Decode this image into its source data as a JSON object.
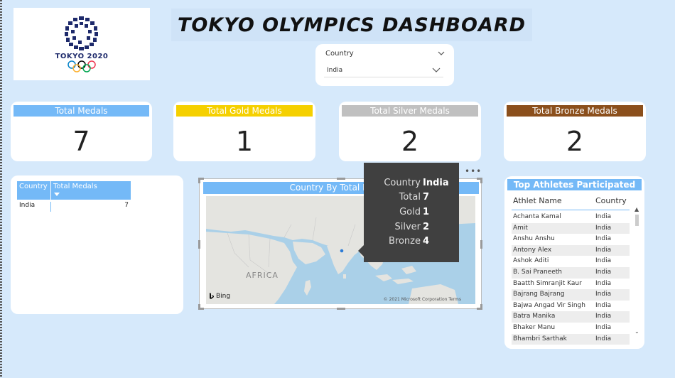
{
  "logo": {
    "text": "TOKYO 2020"
  },
  "title": "TOKYO OLYMPICS DASHBOARD",
  "slicer": {
    "label": "Country",
    "value": "India"
  },
  "kpis": [
    {
      "label": "Total Medals",
      "value": "7",
      "color": "#74b9f7"
    },
    {
      "label": "Total Gold Medals",
      "value": "1",
      "color": "#f5d000"
    },
    {
      "label": "Total Silver Medals",
      "value": "2",
      "color": "#c0c0c0"
    },
    {
      "label": "Total Bronze Medals",
      "value": "2",
      "color": "#8b4f1c"
    }
  ],
  "medal_table": {
    "headers": [
      "Country",
      "Total Medals"
    ],
    "rows": [
      {
        "country": "India",
        "total": "7"
      }
    ]
  },
  "map": {
    "title": "Country By Total Medals",
    "region_label": "AFRICA",
    "provider": "Bing",
    "credit": "© 2021 Microsoft Corporation  Terms"
  },
  "tooltip": {
    "rows": [
      {
        "key": "Country",
        "value": "India"
      },
      {
        "key": "Total",
        "value": "7"
      },
      {
        "key": "Gold",
        "value": "1"
      },
      {
        "key": "Silver",
        "value": "2"
      },
      {
        "key": "Bronze",
        "value": "4"
      }
    ]
  },
  "athletes": {
    "title": "Top Athletes Participated",
    "headers": [
      "Athlet Name",
      "Country"
    ],
    "rows": [
      {
        "name": "Achanta Kamal",
        "country": "India"
      },
      {
        "name": "Amit",
        "country": "India"
      },
      {
        "name": "Anshu Anshu",
        "country": "India"
      },
      {
        "name": "Antony Alex",
        "country": "India"
      },
      {
        "name": "Ashok Aditi",
        "country": "India"
      },
      {
        "name": "B. Sai Praneeth",
        "country": "India"
      },
      {
        "name": "Baatth Simranjit Kaur",
        "country": "India"
      },
      {
        "name": "Bajrang Bajrang",
        "country": "India"
      },
      {
        "name": "Bajwa Angad Vir Singh",
        "country": "India"
      },
      {
        "name": "Batra Manika",
        "country": "India"
      },
      {
        "name": "Bhaker Manu",
        "country": "India"
      },
      {
        "name": "Bhambri Sarthak",
        "country": "India"
      }
    ]
  },
  "colors": {
    "background": "#d6e9fb",
    "accent": "#74b9f7",
    "tooltip": "#404040"
  }
}
